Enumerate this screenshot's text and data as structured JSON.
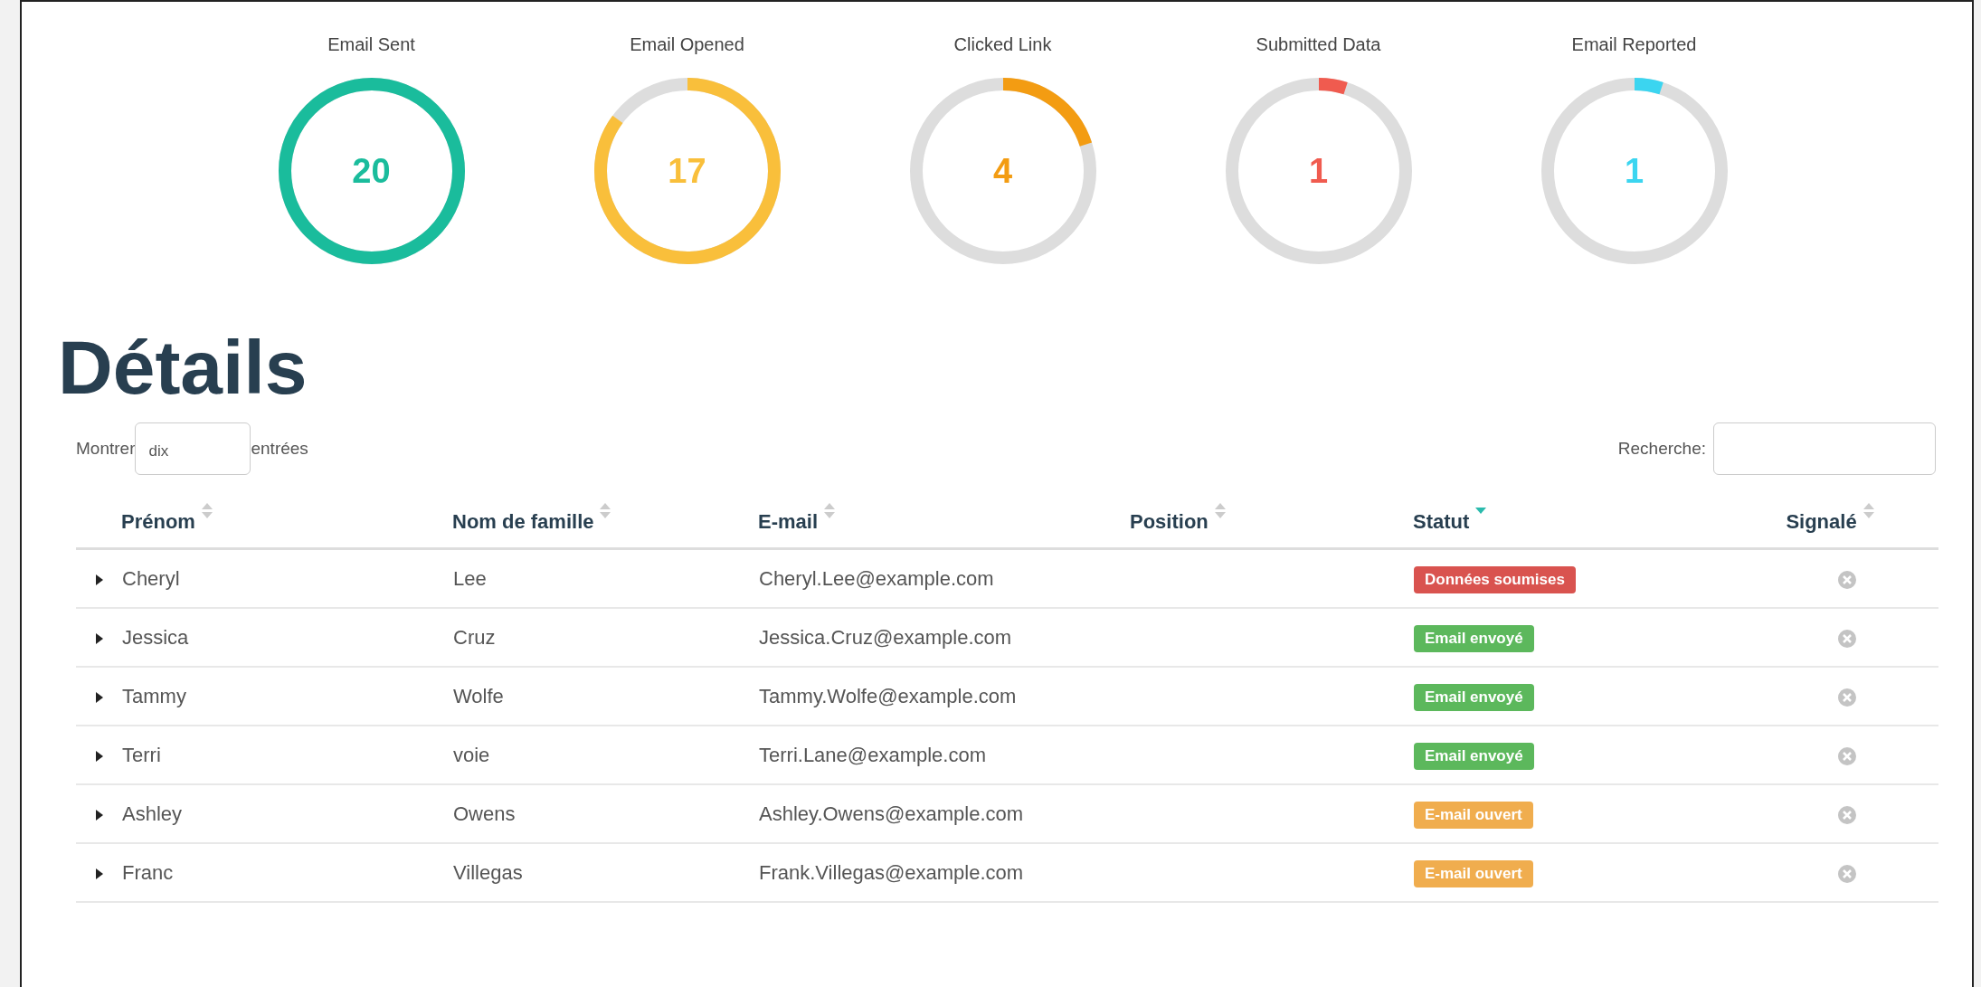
{
  "stats": [
    {
      "label": "Email Sent",
      "value": "20",
      "color": "#1abc9c"
    },
    {
      "label": "Email Opened",
      "value": "17",
      "color": "#f9bf3b"
    },
    {
      "label": "Clicked Link",
      "value": "4",
      "color": "#f39c12"
    },
    {
      "label": "Submitted Data",
      "value": "1",
      "color": "#f05b4f"
    },
    {
      "label": "Email Reported",
      "value": "1",
      "color": "#3bd5f0"
    }
  ],
  "heading": "Détails",
  "length_control": {
    "before": "Montrer",
    "value": "dix",
    "after": "entrées"
  },
  "search": {
    "label": "Recherche:"
  },
  "table": {
    "columns": [
      {
        "label": "Prénom",
        "sorted": false
      },
      {
        "label": "Nom de famille",
        "sorted": false
      },
      {
        "label": "E-mail",
        "sorted": false
      },
      {
        "label": "Position",
        "sorted": false
      },
      {
        "label": "Statut",
        "sorted": true
      },
      {
        "label": "Signalé",
        "sorted": false
      }
    ],
    "rows": [
      {
        "first_name": "Cheryl",
        "last_name": "Lee",
        "email": "Cheryl.Lee@example.com",
        "status": "Données soumises",
        "color": "#d9534f",
        "reported": false
      },
      {
        "first_name": "Jessica",
        "last_name": "Cruz",
        "email": "Jessica.Cruz@example.com",
        "status": "Email envoyé",
        "color": "#5cb85c",
        "reported": false
      },
      {
        "first_name": "Tammy",
        "last_name": "Wolfe",
        "email": "Tammy.Wolfe@example.com",
        "status": "Email envoyé",
        "color": "#5cb85c",
        "reported": false
      },
      {
        "first_name": "Terri",
        "last_name": "voie",
        "email": "Terri.Lane@example.com",
        "status": "Email envoyé",
        "color": "#5cb85c",
        "reported": false
      },
      {
        "first_name": "Ashley",
        "last_name": "Owens",
        "email": "Ashley.Owens@example.com",
        "status": "E-mail ouvert",
        "color": "#f0ad4e",
        "reported": false
      },
      {
        "first_name": "Franc",
        "last_name": "Villegas",
        "email": "Frank.Villegas@example.com",
        "status": "E-mail ouvert",
        "color": "#f0ad4e",
        "reported": false
      }
    ]
  }
}
